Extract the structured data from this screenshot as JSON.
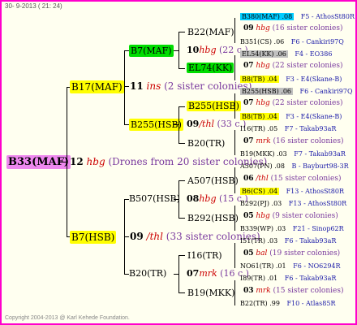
{
  "header": "30-  9-2013 ( 21: 24)",
  "footer": "Copyright 2004-2013 @ Karl Kehede Foundation.",
  "root": {
    "name": "B33(MAF)"
  },
  "gen1": {
    "num": "12",
    "bee": "hbg",
    "note": "(Drones from 20 sister colonies)",
    "upper": {
      "name": "B17(MAF)",
      "num": "11",
      "bee": "ins",
      "note": "(2 sister colonies)"
    },
    "lower": {
      "name": "B7(HSB)",
      "num": "09",
      "bee": "/thl",
      "note": "(33 sister colonies)"
    }
  },
  "gen2": {
    "a": {
      "name": "B7(MAF)",
      "num": "10",
      "bee": "hbg",
      "note": "(22 c.)"
    },
    "b": {
      "name": "B255(HSB)",
      "num": "09",
      "bee": "/thl",
      "note": "(33 c.)"
    },
    "c": {
      "name": "B507(HSB)",
      "num": "08",
      "bee": "hbg",
      "note": "(15 c.)"
    },
    "d": {
      "name": "B20(TR)",
      "num": "07",
      "bee": "mrk",
      "note": "(16 c.)"
    }
  },
  "gen3": [
    {
      "name": "B22(MAF)"
    },
    {
      "name": "EL74(KK)"
    },
    {
      "name": "B255(HSB)"
    },
    {
      "name": "B20(TR)"
    },
    {
      "name": "A507(HSB)"
    },
    {
      "name": "B292(HSB)"
    },
    {
      "name": "I16(TR)"
    },
    {
      "name": "B19(MKK)"
    }
  ],
  "gen4": [
    {
      "left": "B380(MAF) .08",
      "right": "F5 - AthosSt80R",
      "hl": "#00ccff"
    },
    {
      "mid": "09 hbg (16 sister colonies)"
    },
    {
      "left": "B351(CS) .06",
      "right": "F6 - Cankiri97Q"
    },
    {
      "left": "EL54(KK) .06",
      "right": "F4 - EO386",
      "hl": "#c0c0c0"
    },
    {
      "mid": "07 hbg (22 sister colonies)"
    },
    {
      "left": "B8(TB) .04",
      "right": "F3 - E4(Skane-B)",
      "hl": "#ffff00"
    },
    {
      "left": "B255(HSB) .06",
      "right": "F6 - Cankiri97Q",
      "hl": "#c0c0c0"
    },
    {
      "mid": "07 hbg (22 sister colonies)"
    },
    {
      "left": "B8(TB) .04",
      "right": "F3 - E4(Skane-B)",
      "hl": "#ffff00"
    },
    {
      "left": "I16(TR) .05",
      "right": "F7 - Takab93aR"
    },
    {
      "mid": "07 mrk (16 sister colonies)"
    },
    {
      "left": "B19(MKK) .03",
      "right": "F7 - Takab93aR"
    },
    {
      "left": "A507(PN) .08",
      "right": "B - Bayburt98-3R"
    },
    {
      "mid": "06 /thl (15 sister colonies)"
    },
    {
      "left": "B6(CS) .04",
      "right": "F13 - AthosSt80R",
      "hl": "#ffff00"
    },
    {
      "left": "B292(PJ) .03",
      "right": "F13 - AthosSt80R"
    },
    {
      "mid": "05 hbg (9 sister colonies)"
    },
    {
      "left": "B339(WP) .03",
      "right": "F21 - Sinop62R"
    },
    {
      "left": "I51(TR) .03",
      "right": "F6 - Takab93aR"
    },
    {
      "mid": "05 bal (19 sister colonies)"
    },
    {
      "left": "NO61(TR) .01",
      "right": "F6 - NO6294R"
    },
    {
      "left": "I89(TR) .01",
      "right": "F6 - Takab93aR"
    },
    {
      "mid": "03 mrk (15 sister colonies)"
    },
    {
      "left": "B22(TR) .99",
      "right": "F10 - Atlas85R"
    }
  ],
  "colors": {
    "frame": "#ff00cc",
    "pink": "#ee88ee",
    "yellow": "#ffff00",
    "green": "#00dd00",
    "cyan": "#00ccff",
    "gray": "#c0c0c0"
  }
}
